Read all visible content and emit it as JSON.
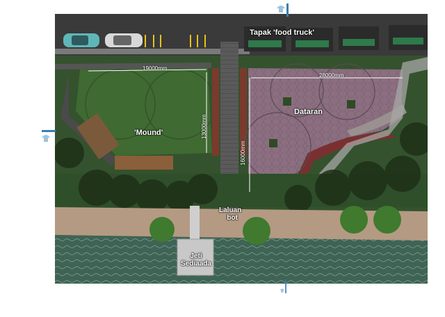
{
  "labels": {
    "food_truck": "Tapak 'food truck'",
    "mound": "'Mound'",
    "plaza": "Dataran",
    "boat_path_line1": "Laluan",
    "boat_path_line2": "bot",
    "jetty_line1": "Jeti",
    "jetty_line2": "Sediaada"
  },
  "dimensions": {
    "mound_width": "19000mm",
    "mound_depth": "13000mm",
    "plaza_width": "28000mm",
    "plaza_depth": "16000mm"
  },
  "icons": [
    "view-arrow-top",
    "view-arrow-left",
    "view-arrow-bottom"
  ],
  "colors": {
    "grass": "#3f6a32",
    "dark_green": "#2f4a2a",
    "road": "#3a3a3a",
    "plaza_paving": "#8a6e7d",
    "plaza_red": "#7a3030",
    "sand": "#b89a80",
    "water": "#4d6f5f",
    "arrow": "#4a8fb8"
  }
}
